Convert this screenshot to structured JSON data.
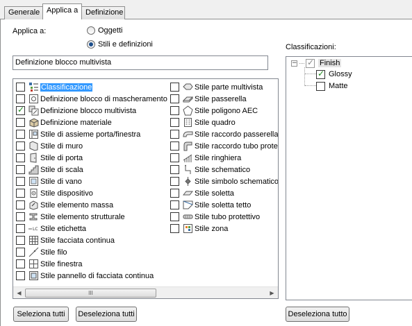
{
  "tabs": [
    {
      "label": "Generale"
    },
    {
      "label": "Applica a"
    },
    {
      "label": "Definizione"
    }
  ],
  "apply_to": {
    "label": "Applica a:",
    "options": [
      {
        "label": "Oggetti",
        "selected": false
      },
      {
        "label": "Stili e definizioni",
        "selected": true
      }
    ]
  },
  "selected_field": {
    "value": "Definizione blocco multivista"
  },
  "style_list": {
    "column1": [
      {
        "label": "Classificazione",
        "checked": false,
        "highlighted": true,
        "icon": "classification-icon"
      },
      {
        "label": "Definizione blocco di mascheramento",
        "checked": false,
        "icon": "mask-block-icon"
      },
      {
        "label": "Definizione blocco multivista",
        "checked": true,
        "icon": "multiview-block-icon"
      },
      {
        "label": "Definizione materiale",
        "checked": false,
        "icon": "material-icon"
      },
      {
        "label": "Stile di assieme porta/finestra",
        "checked": false,
        "icon": "door-window-assembly-icon"
      },
      {
        "label": "Stile di muro",
        "checked": false,
        "icon": "wall-icon"
      },
      {
        "label": "Stile di porta",
        "checked": false,
        "icon": "door-icon"
      },
      {
        "label": "Stile di scala",
        "checked": false,
        "icon": "stair-icon"
      },
      {
        "label": "Stile di vano",
        "checked": false,
        "icon": "opening-icon"
      },
      {
        "label": "Stile dispositivo",
        "checked": false,
        "icon": "device-icon"
      },
      {
        "label": "Stile elemento massa",
        "checked": false,
        "icon": "mass-element-icon"
      },
      {
        "label": "Stile elemento strutturale",
        "checked": false,
        "icon": "structural-member-icon"
      },
      {
        "label": "Stile etichetta",
        "checked": false,
        "icon": "label-icon"
      },
      {
        "label": "Stile facciata continua",
        "checked": false,
        "icon": "curtain-wall-icon"
      },
      {
        "label": "Stile filo",
        "checked": false,
        "icon": "wire-icon"
      },
      {
        "label": "Stile finestra",
        "checked": false,
        "icon": "window-icon"
      },
      {
        "label": "Stile pannello di facciata continua",
        "checked": false,
        "icon": "curtain-panel-icon"
      }
    ],
    "column2": [
      {
        "label": "Stile parte multivista",
        "checked": false,
        "icon": "multiview-part-icon"
      },
      {
        "label": "Stile passerella",
        "checked": false,
        "icon": "cable-tray-icon"
      },
      {
        "label": "Stile poligono AEC",
        "checked": false,
        "icon": "polygon-icon"
      },
      {
        "label": "Stile quadro",
        "checked": false,
        "icon": "panel-icon"
      },
      {
        "label": "Stile raccordo passerella",
        "checked": false,
        "icon": "tray-fitting-icon"
      },
      {
        "label": "Stile raccordo tubo protettivo",
        "checked": false,
        "icon": "conduit-fitting-icon"
      },
      {
        "label": "Stile ringhiera",
        "checked": false,
        "icon": "railing-icon"
      },
      {
        "label": "Stile schematico",
        "checked": false,
        "icon": "schematic-icon"
      },
      {
        "label": "Stile simbolo schematico",
        "checked": false,
        "icon": "schematic-symbol-icon"
      },
      {
        "label": "Stile soletta",
        "checked": false,
        "icon": "slab-icon"
      },
      {
        "label": "Stile soletta tetto",
        "checked": false,
        "icon": "roof-slab-icon"
      },
      {
        "label": "Stile tubo protettivo",
        "checked": false,
        "icon": "conduit-icon"
      },
      {
        "label": "Stile zona",
        "checked": false,
        "icon": "zone-icon"
      }
    ],
    "scrollbar_grip": "III"
  },
  "classifications": {
    "label": "Classificazioni:",
    "root": {
      "label": "Finish",
      "checked": true,
      "expanded": true
    },
    "children": [
      {
        "label": "Glossy",
        "checked": true
      },
      {
        "label": "Matte",
        "checked": false
      }
    ]
  },
  "buttons": {
    "select_all": "Seleziona tutti",
    "deselect_all": "Deseleziona tutti",
    "deselect_all_class": "Deseleziona tutto"
  }
}
